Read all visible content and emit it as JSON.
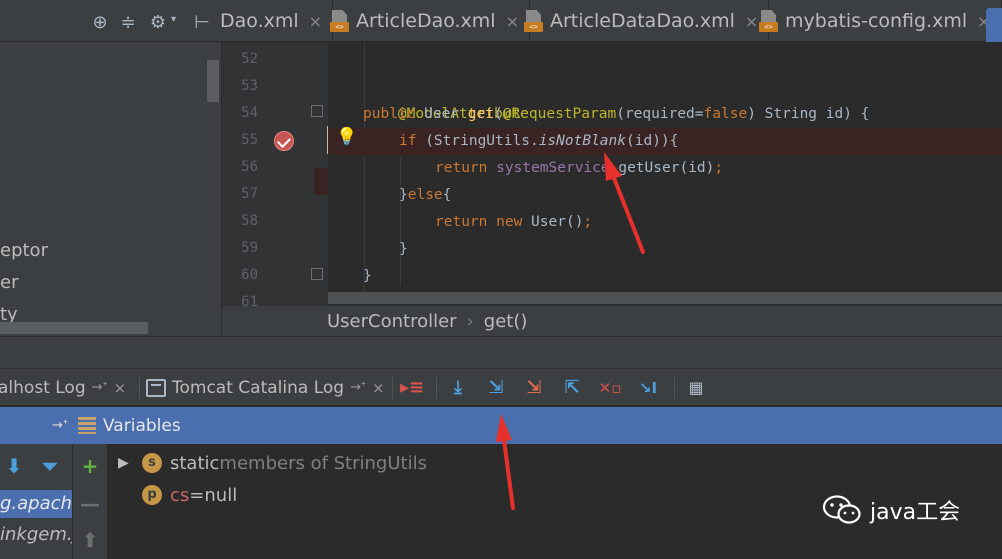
{
  "editor_tabs": [
    {
      "label": "Dao.xml",
      "active": false
    },
    {
      "label": "ArticleDao.xml",
      "active": false
    },
    {
      "label": "ArticleDataDao.xml",
      "active": false
    },
    {
      "label": "mybatis-config.xml",
      "active": false
    }
  ],
  "toolbar_icons": [
    "target-icon",
    "collapse-icon",
    "gear-icon",
    "hide-icon"
  ],
  "project_tree": [
    {
      "text": "eptor"
    },
    {
      "text": "er"
    },
    {
      "text": "ty"
    }
  ],
  "line_numbers": [
    "52",
    "53",
    "54",
    "55",
    "56",
    "57",
    "58",
    "59",
    "60",
    "61"
  ],
  "code": {
    "l53_annotation": "@ModelAttribute",
    "l54_public": "public",
    "l54_type": " User ",
    "l54_method": "get",
    "l54_open": "(",
    "l54_param_ann": "@RequestParam",
    "l54_paren": "(",
    "l54_required": "required",
    "l54_eq": "=",
    "l54_false": "false",
    "l54_rest": ") String id) {",
    "l55_if": "if",
    "l55_open": " (StringUtils.",
    "l55_call": "isNotBlank",
    "l55_rest": "(id)){",
    "l56_return": "return",
    "l56_field": " systemService",
    "l56_rest": ".getUser(id)",
    "l56_semi": ";",
    "l57_open": "}",
    "l57_else": "else",
    "l57_rest": "{",
    "l58_return": "return",
    "l58_new": " new",
    "l58_rest": " User()",
    "l58_semi": ";",
    "l59_close": "}",
    "l60_close": "}"
  },
  "breadcrumb": {
    "class": "UserController",
    "separator": "›",
    "method": "get()"
  },
  "debug_tabs": [
    {
      "label": "alhost Log",
      "pin": "→ᐩ",
      "close": "×"
    },
    {
      "label": "Tomcat Catalina Log",
      "pin": "→ᐩ",
      "close": "×"
    }
  ],
  "debug_buttons": [
    "show-execution-point-icon",
    "step-over-icon",
    "step-into-icon",
    "force-step-into-icon",
    "step-out-icon",
    "drop-frame-icon",
    "run-to-cursor-icon",
    "evaluate-expression-icon"
  ],
  "variables": {
    "pin": "→ᐩ",
    "title": "Variables",
    "rows": [
      {
        "expander": "▶",
        "badge": "s",
        "name": "static",
        "dim": " members of StringUtils",
        "eq": "",
        "value": ""
      },
      {
        "expander": "",
        "badge": "p",
        "name": "cs",
        "dim": "",
        "eq": " = ",
        "value": "null"
      }
    ]
  },
  "frames": [
    {
      "text": "g.apache",
      "selected": true
    },
    {
      "text": "inkgem.j",
      "selected": false
    }
  ],
  "watermark": "java工会",
  "colors": {
    "breakpoint": "#c75450",
    "arrow": "#e8302a",
    "selection": "#4b6eaf"
  }
}
